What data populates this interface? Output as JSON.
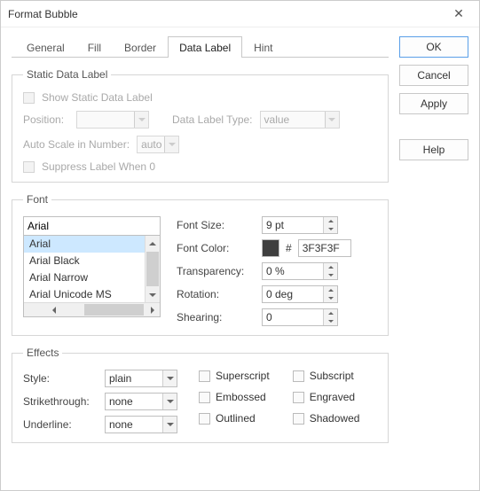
{
  "window": {
    "title": "Format Bubble"
  },
  "tabs": [
    "General",
    "Fill",
    "Border",
    "Data Label",
    "Hint"
  ],
  "activeTab": "Data Label",
  "staticDataLabel": {
    "legend": "Static Data Label",
    "showLabel": "Show Static Data Label",
    "positionLabel": "Position:",
    "positionValue": "",
    "dataLabelTypeLabel": "Data Label Type:",
    "dataLabelTypeValue": "value",
    "autoScaleLabel": "Auto Scale in Number:",
    "autoScaleValue": "auto",
    "suppressLabel": "Suppress Label When 0"
  },
  "font": {
    "legend": "Font",
    "selected": "Arial",
    "list": [
      "Arial",
      "Arial Black",
      "Arial Narrow",
      "Arial Unicode MS"
    ],
    "sizeLabel": "Font Size:",
    "sizeValue": "9 pt",
    "colorLabel": "Font Color:",
    "colorHash": "#",
    "colorValue": "3F3F3F",
    "colorSwatch": "#3F3F3F",
    "transparencyLabel": "Transparency:",
    "transparencyValue": "0 %",
    "rotationLabel": "Rotation:",
    "rotationValue": "0 deg",
    "shearingLabel": "Shearing:",
    "shearingValue": "0"
  },
  "effects": {
    "legend": "Effects",
    "styleLabel": "Style:",
    "styleValue": "plain",
    "strikethroughLabel": "Strikethrough:",
    "strikethroughValue": "none",
    "underlineLabel": "Underline:",
    "underlineValue": "none",
    "superscript": "Superscript",
    "subscript": "Subscript",
    "embossed": "Embossed",
    "engraved": "Engraved",
    "outlined": "Outlined",
    "shadowed": "Shadowed"
  },
  "buttons": {
    "ok": "OK",
    "cancel": "Cancel",
    "apply": "Apply",
    "help": "Help"
  }
}
